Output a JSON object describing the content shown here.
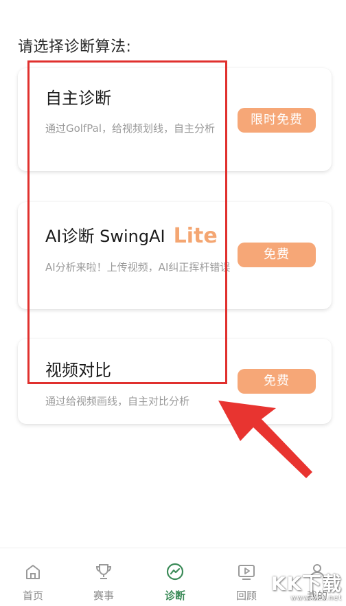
{
  "header": {
    "title": "请选择诊断算法:"
  },
  "cards": [
    {
      "title": "自主诊断",
      "description": "通过GolfPal，给视频划线，自主分析",
      "price": "限时免费"
    },
    {
      "title": "AI诊断 SwingAI",
      "title_badge": "Lite",
      "description": "AI分析来啦！上传视频，AI纠正挥杆错误",
      "price": "免费"
    },
    {
      "title": "视频对比",
      "description": "通过给视频画线，自主对比分析",
      "price": "免费"
    }
  ],
  "tabbar": {
    "items": [
      {
        "label": "首页",
        "icon": "home-icon",
        "active": false
      },
      {
        "label": "赛事",
        "icon": "trophy-icon",
        "active": false
      },
      {
        "label": "诊断",
        "icon": "diagnosis-icon",
        "active": true
      },
      {
        "label": "回顾",
        "icon": "video-playback-icon",
        "active": false
      },
      {
        "label": "我的",
        "icon": "user-icon",
        "active": false
      }
    ]
  },
  "watermark": {
    "text": "KK下载",
    "url": "www.kkx.net"
  },
  "colors": {
    "accent": "#f6a777",
    "lite": "#f4a672",
    "active_tab": "#3a8a57",
    "highlight": "#e0302e"
  }
}
